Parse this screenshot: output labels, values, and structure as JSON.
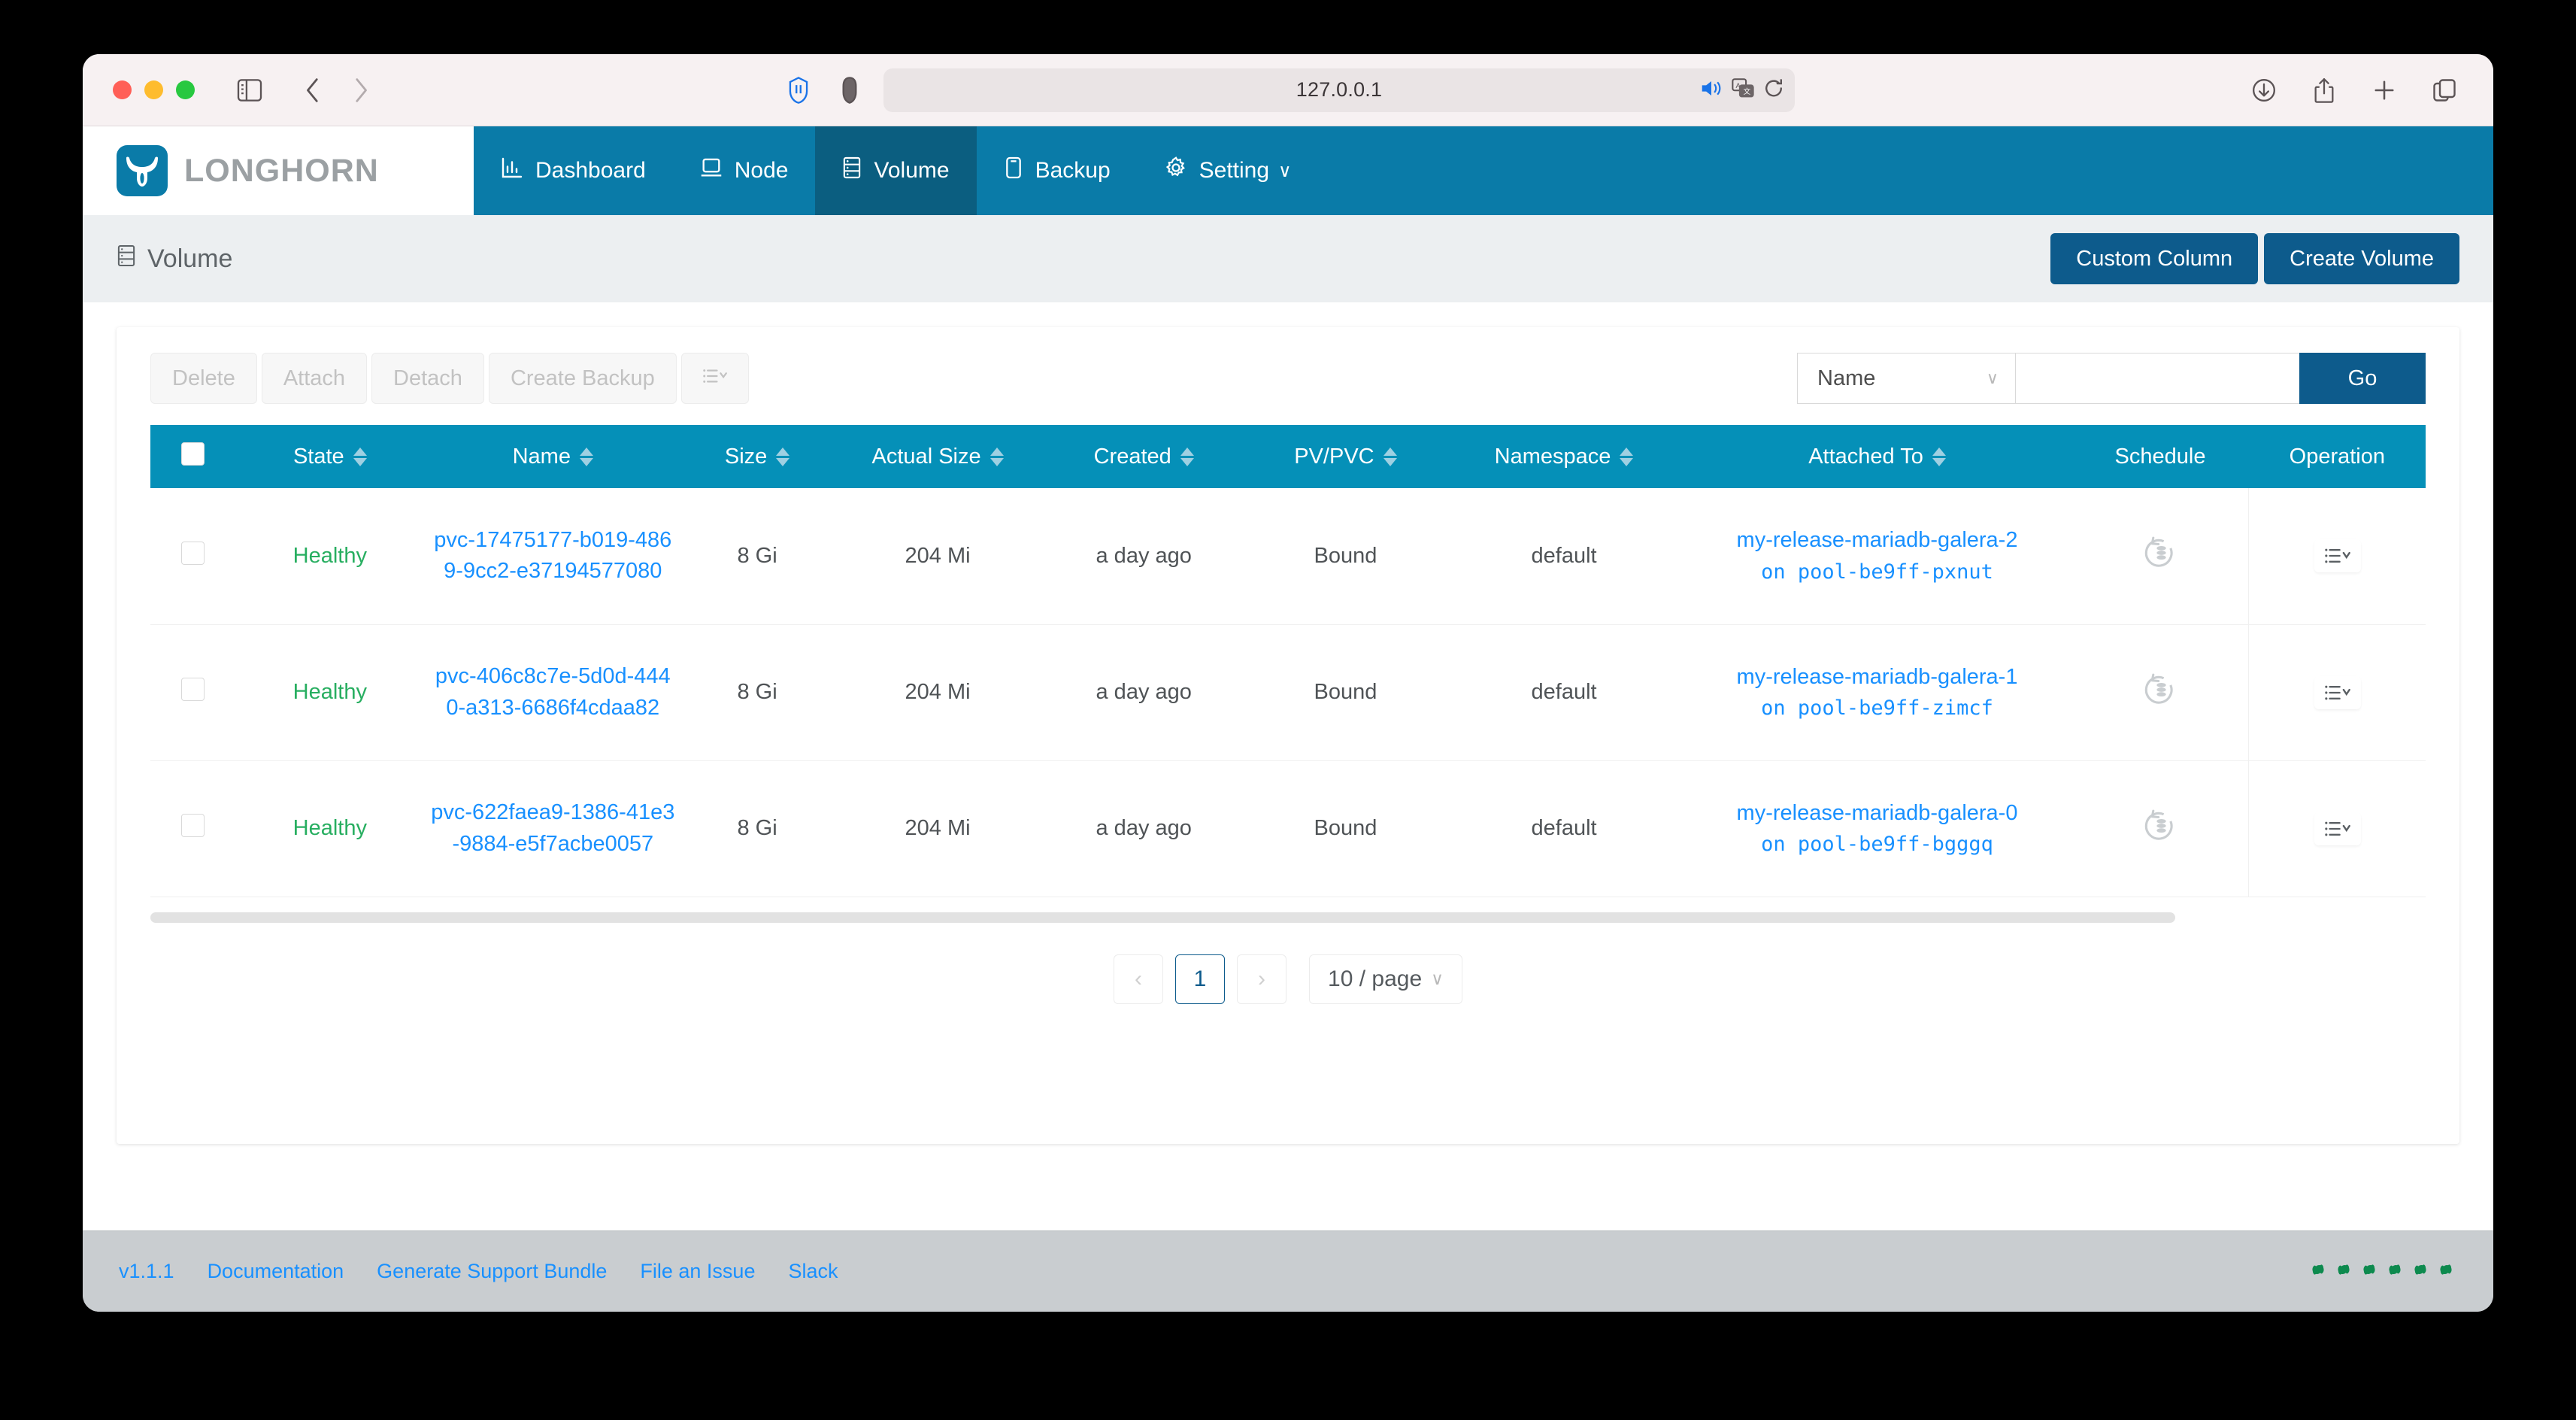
{
  "browser": {
    "url": "127.0.0.1",
    "icons": {
      "sidebar": "sidebar-icon",
      "back": "back-arrow-icon",
      "forward": "forward-arrow-icon",
      "shield_blue": "pause-shield-icon",
      "shield_grey": "privacy-shield-icon",
      "sound": "sound-icon",
      "translate": "translate-icon",
      "reload": "reload-icon",
      "download": "download-icon",
      "share": "share-icon",
      "newtab": "plus-icon",
      "tabs": "tabs-overview-icon"
    }
  },
  "brand": {
    "name": "LONGHORN",
    "logo": "longhorn-bull-logo",
    "accent": "#0a7ba8"
  },
  "nav": {
    "items": [
      {
        "label": "Dashboard",
        "icon": "chart-icon",
        "active": false
      },
      {
        "label": "Node",
        "icon": "laptop-icon",
        "active": false
      },
      {
        "label": "Volume",
        "icon": "server-icon",
        "active": true
      },
      {
        "label": "Backup",
        "icon": "device-icon",
        "active": false
      },
      {
        "label": "Setting",
        "icon": "gear-icon",
        "active": false,
        "caret": "∨"
      }
    ]
  },
  "page": {
    "title": "Volume",
    "title_icon": "server-icon",
    "custom_column_label": "Custom Column",
    "create_volume_label": "Create Volume"
  },
  "toolbar": {
    "delete_label": "Delete",
    "attach_label": "Attach",
    "detach_label": "Detach",
    "create_backup_label": "Create Backup",
    "more_icon": "list-chevron-icon"
  },
  "search": {
    "field": "Name",
    "value": "",
    "placeholder": "",
    "go_label": "Go",
    "caret": "∨"
  },
  "table": {
    "columns": [
      {
        "label": "State",
        "sortable": true
      },
      {
        "label": "Name",
        "sortable": true
      },
      {
        "label": "Size",
        "sortable": true
      },
      {
        "label": "Actual Size",
        "sortable": true
      },
      {
        "label": "Created",
        "sortable": true
      },
      {
        "label": "PV/PVC",
        "sortable": true
      },
      {
        "label": "Namespace",
        "sortable": true
      },
      {
        "label": "Attached To",
        "sortable": true
      },
      {
        "label": "Schedule",
        "sortable": false
      },
      {
        "label": "Operation",
        "sortable": false
      }
    ],
    "rows": [
      {
        "state": "Healthy",
        "name": "pvc-17475177-b019-4869-9cc2-e37194577080",
        "size": "8 Gi",
        "actual_size": "204 Mi",
        "created": "a day ago",
        "pvpvc": "Bound",
        "namespace": "default",
        "attached_pod": "my-release-mariadb-galera-2",
        "attached_node": "on pool-be9ff-pxnut",
        "schedule_icon": "recurring-job-icon",
        "operation_icon": "list-chevron-icon"
      },
      {
        "state": "Healthy",
        "name": "pvc-406c8c7e-5d0d-4440-a313-6686f4cdaa82",
        "size": "8 Gi",
        "actual_size": "204 Mi",
        "created": "a day ago",
        "pvpvc": "Bound",
        "namespace": "default",
        "attached_pod": "my-release-mariadb-galera-1",
        "attached_node": "on pool-be9ff-zimcf",
        "schedule_icon": "recurring-job-icon",
        "operation_icon": "list-chevron-icon"
      },
      {
        "state": "Healthy",
        "name": "pvc-622faea9-1386-41e3-9884-e5f7acbe0057",
        "size": "8 Gi",
        "actual_size": "204 Mi",
        "created": "a day ago",
        "pvpvc": "Bound",
        "namespace": "default",
        "attached_pod": "my-release-mariadb-galera-0",
        "attached_node": "on pool-be9ff-bgggq",
        "schedule_icon": "recurring-job-icon",
        "operation_icon": "list-chevron-icon"
      }
    ]
  },
  "pagination": {
    "prev": "‹",
    "current_page": "1",
    "next": "›",
    "page_size": "10 / page",
    "caret": "∨"
  },
  "footer": {
    "version": "v1.1.1",
    "links": [
      "Documentation",
      "Generate Support Bundle",
      "File an Issue",
      "Slack"
    ],
    "chain_count": 6,
    "chain_color": "#0d8a4e"
  },
  "colors": {
    "nav_bg": "#0a7ba8",
    "nav_active": "#0b5e80",
    "table_header": "#0590b8",
    "primary_button": "#0d5b8c",
    "link": "#1890ff",
    "healthy": "#27ae60"
  }
}
